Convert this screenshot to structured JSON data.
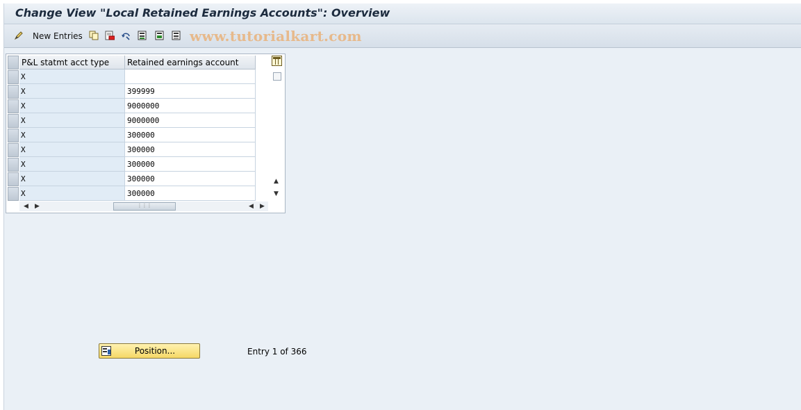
{
  "window": {
    "title": "Change View \"Local Retained Earnings Accounts\": Overview"
  },
  "toolbar": {
    "new_entries_label": "New Entries",
    "watermark": "www.tutorialkart.com",
    "icons": [
      "display-change-icon",
      "copy-icon",
      "delete-icon",
      "undo-icon",
      "select-all-icon",
      "select-block-icon",
      "deselect-all-icon"
    ]
  },
  "table": {
    "columns": [
      "P&L statmt acct type",
      "Retained earnings account"
    ],
    "rows": [
      {
        "type": "X",
        "account": ""
      },
      {
        "type": "X",
        "account": "399999"
      },
      {
        "type": "X",
        "account": "9000000"
      },
      {
        "type": "X",
        "account": "9000000"
      },
      {
        "type": "X",
        "account": "300000"
      },
      {
        "type": "X",
        "account": "300000"
      },
      {
        "type": "X",
        "account": "300000"
      },
      {
        "type": "X",
        "account": "300000"
      },
      {
        "type": "X",
        "account": "300000"
      }
    ]
  },
  "footer": {
    "position_button": "Position...",
    "entry_info": "Entry 1 of 366"
  }
}
